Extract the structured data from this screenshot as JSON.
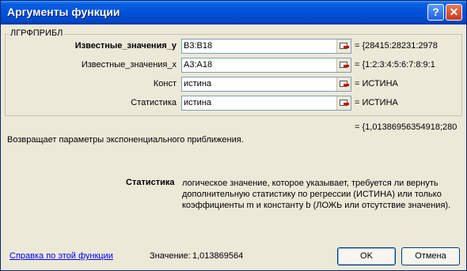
{
  "window": {
    "title": "Аргументы функции"
  },
  "group": {
    "label": "ЛГРФПРИБЛ"
  },
  "args": [
    {
      "label": "Известные_значения_у",
      "value": "B3:B18",
      "result": "= {28415:28231:2978"
    },
    {
      "label": "Известные_значения_х",
      "value": "A3:A18",
      "result": "= {1:2:3:4:5:6:7:8:9:1"
    },
    {
      "label": "Конст",
      "value": "истина",
      "result": "= ИСТИНА"
    },
    {
      "label": "Статистика",
      "value": "истина",
      "result": "= ИСТИНА"
    }
  ],
  "formula_result": "= {1,01386956354918;280",
  "description": "Возвращает параметры экспоненциального приближения.",
  "arg_help": {
    "name": "Статистика",
    "text": "логическое значение, которое указывает, требуется ли вернуть дополнительную статистику по регрессии (ИСТИНА) или только коэффициенты m и константу b (ЛОЖЬ или отсутствие значения)."
  },
  "help_link": "Справка по этой функции",
  "value_label": "Значение:",
  "value": "1,013869564",
  "buttons": {
    "ok": "OK",
    "cancel": "Отмена"
  }
}
